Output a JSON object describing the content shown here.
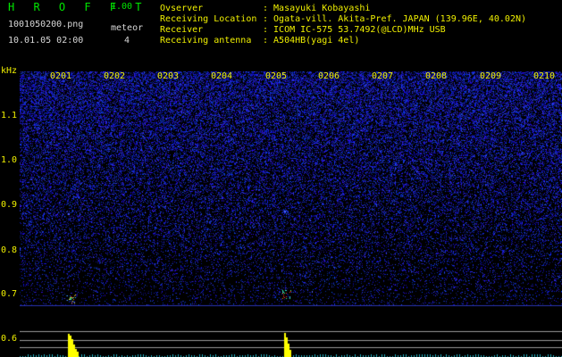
{
  "app": {
    "title": "H R O F F T",
    "version": "1.00"
  },
  "file": {
    "name": "1001050200.png",
    "datetime": "10.01.05 02:00"
  },
  "counter": {
    "label": "meteor",
    "value": "4"
  },
  "info": [
    {
      "label": "Ovserver",
      "value": ": Masayuki Kobayashi"
    },
    {
      "label": "Receiving Location",
      "value": ": Ogata-vill. Akita-Pref. JAPAN (139.96E, 40.02N)"
    },
    {
      "label": "Receiver",
      "value": ": ICOM IC-575 53.7492(@LCD)MHz USB"
    },
    {
      "label": "Receiving antenna",
      "value": ": A504HB(yagi 4el)"
    }
  ],
  "time_ticks": [
    "0201",
    "0202",
    "0203",
    "0204",
    "0205",
    "0206",
    "0207",
    "0208",
    "0209",
    "0210"
  ],
  "freq_axis": {
    "unit": "kHz",
    "labels": [
      "1.1",
      "1.0",
      "0.9",
      "0.8",
      "0.7",
      "0.6"
    ]
  },
  "colors": {
    "title": "#00e600",
    "label": "#f0f000",
    "noise": "#1a2aa8",
    "signal_peak": "#ffff00"
  }
}
